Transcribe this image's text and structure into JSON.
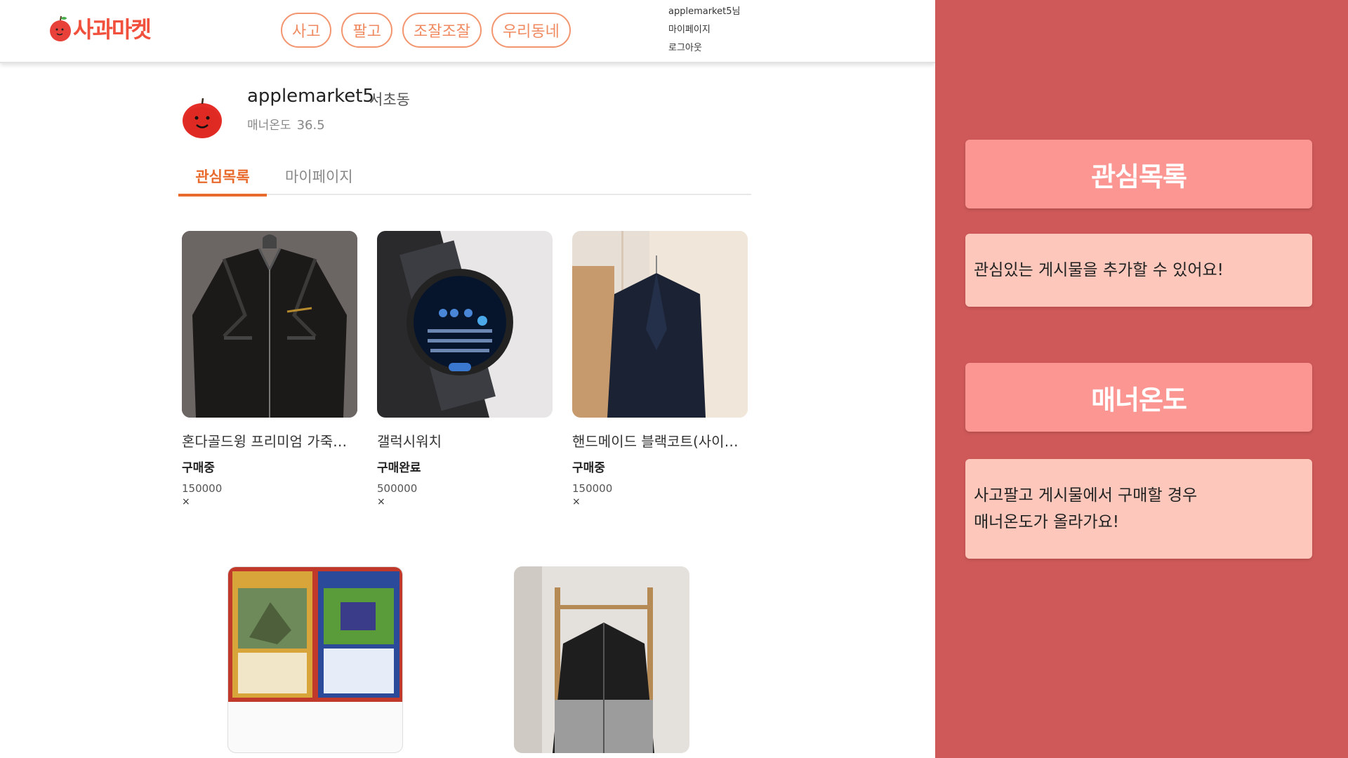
{
  "header": {
    "logo_text": "사과마켓",
    "nav": [
      "사고",
      "팔고",
      "조잘조잘",
      "우리동네"
    ],
    "user": {
      "greeting": "applemarket5님",
      "mypage": "마이페이지",
      "logout": "로그아웃"
    }
  },
  "profile": {
    "username": "applemarket5",
    "town": "서초동",
    "manner_label": "매너온도",
    "manner_value": "36.5"
  },
  "tabs": {
    "active": "관심목록",
    "other": "마이페이지"
  },
  "items": [
    {
      "title": "혼다골드윙 프리미엄 가죽자...",
      "status": "구매중",
      "price": "150000",
      "remove": "×",
      "image": "leather-jacket"
    },
    {
      "title": "갤럭시워치",
      "status": "구매완료",
      "price": "500000",
      "remove": "×",
      "image": "smartwatch"
    },
    {
      "title": "핸드메이드 블랙코트(사이즈...",
      "status": "구매중",
      "price": "150000",
      "remove": "×",
      "image": "black-coat"
    }
  ],
  "items_row2": [
    {
      "image": "trading-cards"
    },
    {
      "image": "zip-jacket"
    }
  ],
  "guide": {
    "watchlist_title": "관심목록",
    "watchlist_desc": "관심있는 게시물을 추가할 수 있어요!",
    "manner_title": "매너온도",
    "manner_desc_line1": "사고팔고 게시물에서 구매할 경우",
    "manner_desc_line2": "매너온도가 올라가요!"
  },
  "colors": {
    "brand": "#f0503c",
    "accent_tab": "#e86a2c",
    "nav_border": "#f3956f",
    "guide_bg": "#cf5959",
    "guide_head": "#fb9693",
    "guide_body": "#fdc8bb"
  }
}
